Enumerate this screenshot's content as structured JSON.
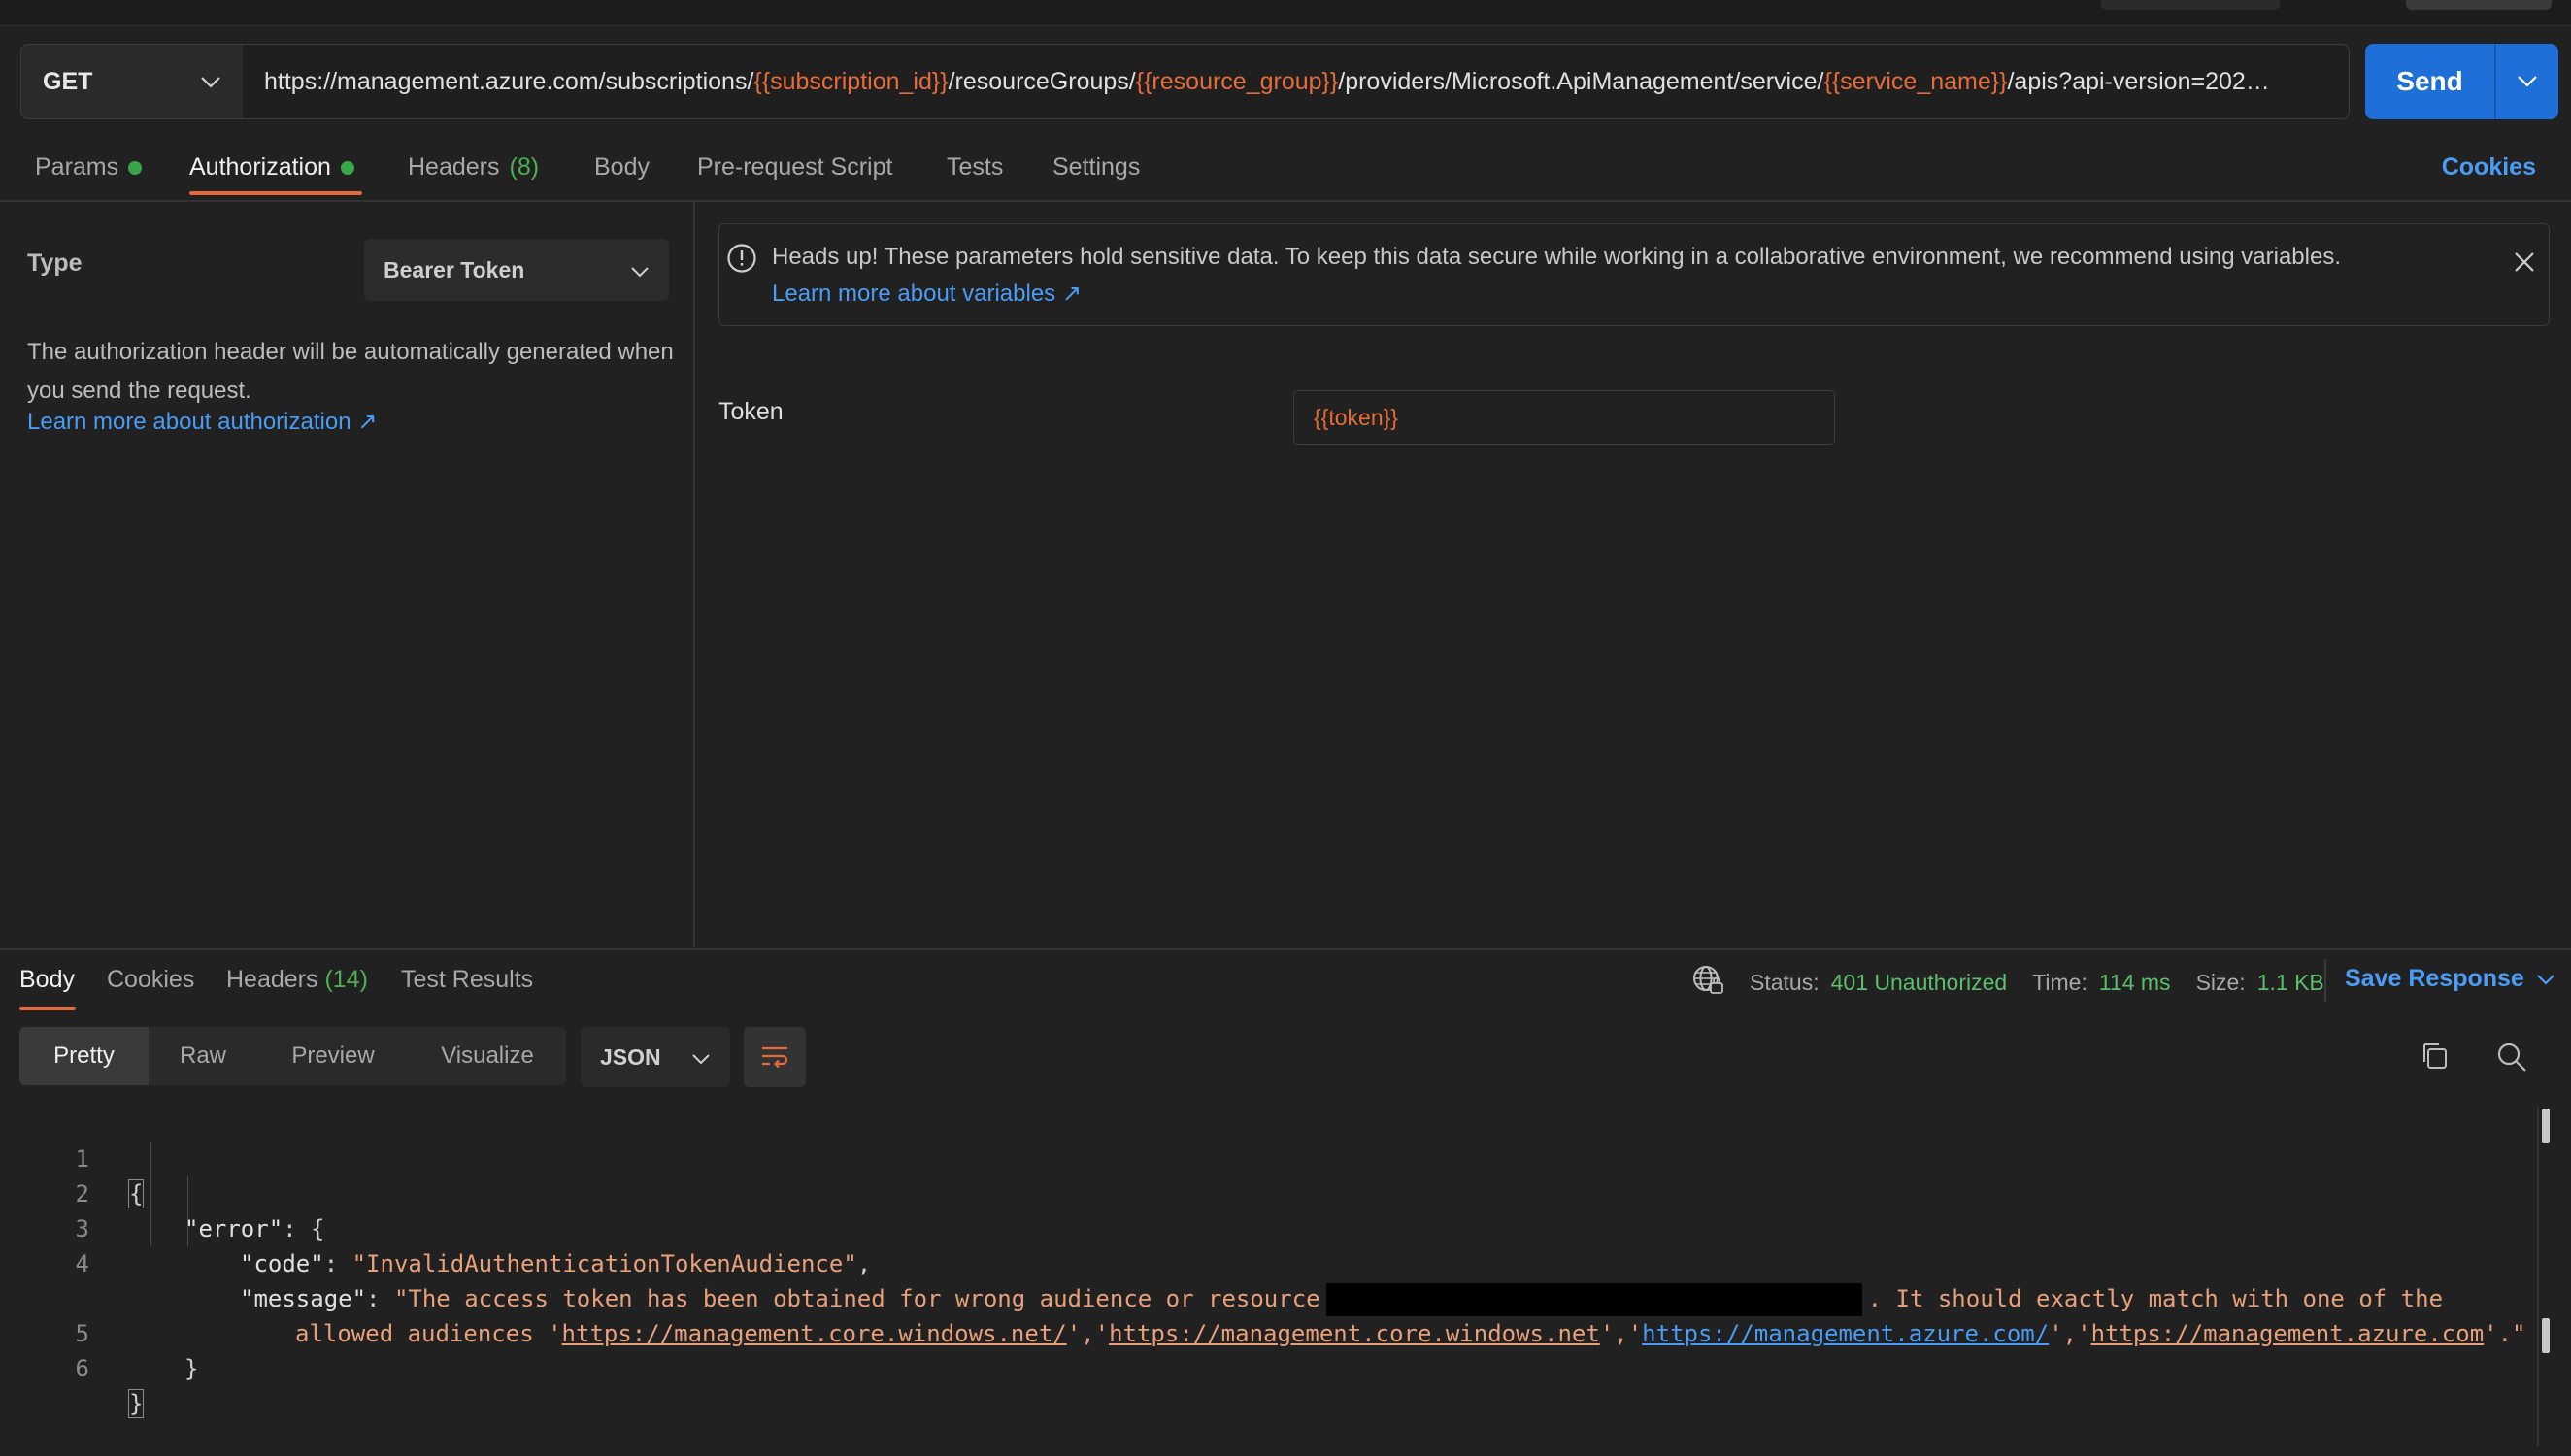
{
  "request": {
    "method": "GET",
    "url_parts": [
      {
        "t": "https://management.azure.com/subscriptions/",
        "v": false
      },
      {
        "t": "{{subscription_id}}",
        "v": true
      },
      {
        "t": "/resourceGroups/",
        "v": false
      },
      {
        "t": "{{resource_group}}",
        "v": true
      },
      {
        "t": "/providers/Microsoft.ApiManagement/service/",
        "v": false
      },
      {
        "t": "{{service_name}}",
        "v": true
      },
      {
        "t": "/apis?api-version=202…",
        "v": false
      }
    ],
    "send_label": "Send"
  },
  "req_tabs": {
    "params": "Params",
    "authorization": "Authorization",
    "headers": "Headers",
    "headers_count": "(8)",
    "body": "Body",
    "prerequest": "Pre-request Script",
    "tests": "Tests",
    "settings": "Settings",
    "cookies": "Cookies"
  },
  "auth": {
    "type_label": "Type",
    "type_value": "Bearer Token",
    "description": "The authorization header will be automatically generated when you send the request.",
    "learn_link": "Learn more about authorization ↗",
    "banner_text": "Heads up! These parameters hold sensitive data. To keep this data secure while working in a collaborative environment, we recommend using variables.",
    "banner_link": "Learn more about variables ↗",
    "token_label": "Token",
    "token_value": "{{token}}"
  },
  "response": {
    "tabs": {
      "body": "Body",
      "cookies": "Cookies",
      "headers": "Headers",
      "headers_count": "(14)",
      "test_results": "Test Results"
    },
    "status_label": "Status:",
    "status_value": "401 Unauthorized",
    "time_label": "Time:",
    "time_value": "114 ms",
    "size_label": "Size:",
    "size_value": "1.1 KB",
    "save_label": "Save Response",
    "views": [
      "Pretty",
      "Raw",
      "Preview",
      "Visualize"
    ],
    "format": "JSON",
    "line_numbers": [
      "1",
      "2",
      "3",
      "4",
      "",
      "5",
      "6"
    ],
    "json": {
      "error_key": "\"error\"",
      "code_key": "\"code\"",
      "code_value": "\"InvalidAuthenticationTokenAudience\"",
      "message_key": "\"message\"",
      "message_part1": "\"The access token has been obtained for wrong audience or resource",
      "message_part2": ". It should exactly match with one of the",
      "allowed_prefix": "allowed audiences '",
      "aud1": "https://management.core.windows.net/",
      "aud2": "https://management.core.windows.net",
      "aud3": "https://management.azure.com/",
      "aud4": "https://management.azure.com",
      "allowed_suffix": "'.\""
    }
  },
  "icons": {
    "chevron": "chevron-down-icon",
    "info": "info-icon",
    "close": "close-icon",
    "globe": "globe-icon",
    "wrap": "wrap-lines-icon",
    "copy": "copy-icon",
    "search": "search-icon"
  },
  "colors": {
    "accent": "#e8693a",
    "variable": "#e66c3a",
    "link": "#4a9cf5",
    "send": "#1f6fd8",
    "status_ok": "#5cbf6a"
  }
}
